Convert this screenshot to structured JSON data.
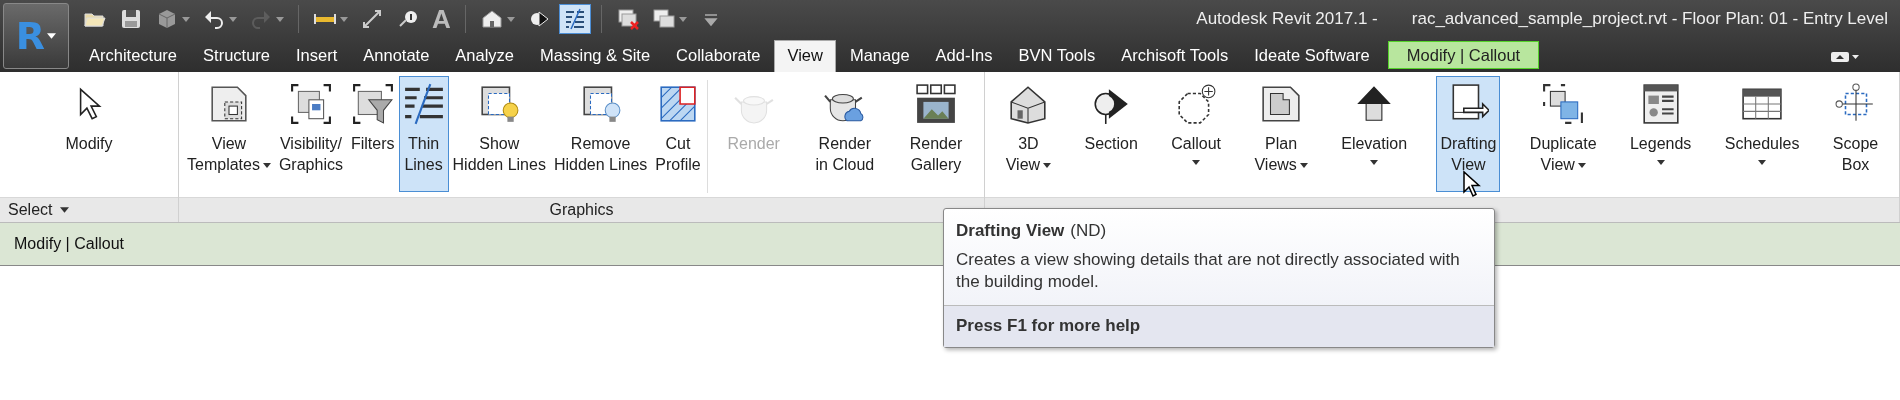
{
  "title_bar": {
    "app_button": {
      "label": "R"
    },
    "quick_access": [
      [
        {
          "kind": "open",
          "dropdown": false,
          "disabled": false,
          "active": false
        },
        {
          "kind": "save",
          "dropdown": false,
          "disabled": false,
          "active": false
        },
        {
          "kind": "sync",
          "dropdown": true,
          "disabled": false,
          "active": false
        },
        {
          "kind": "undo",
          "dropdown": true,
          "disabled": false,
          "active": false
        },
        {
          "kind": "redo",
          "dropdown": true,
          "disabled": true,
          "active": false
        }
      ],
      [
        {
          "kind": "measure",
          "dropdown": true,
          "disabled": false,
          "active": false
        },
        {
          "kind": "dimension",
          "dropdown": false,
          "disabled": false,
          "active": false
        },
        {
          "kind": "tag",
          "dropdown": false,
          "disabled": false,
          "active": false
        },
        {
          "kind": "text",
          "label": "A",
          "dropdown": false,
          "disabled": false,
          "active": false
        }
      ],
      [
        {
          "kind": "house",
          "dropdown": true,
          "disabled": false,
          "active": false
        },
        {
          "kind": "section",
          "dropdown": false,
          "disabled": false,
          "active": false
        },
        {
          "kind": "thin-lines",
          "dropdown": false,
          "disabled": false,
          "active": true
        }
      ],
      [
        {
          "kind": "close-windows",
          "dropdown": false,
          "disabled": false,
          "active": false
        },
        {
          "kind": "switch-windows",
          "dropdown": true,
          "disabled": false,
          "active": false
        },
        {
          "kind": "customize",
          "dropdown": false,
          "disabled": false,
          "active": false
        }
      ]
    ],
    "app_name": "Autodesk Revit 2017.1 -",
    "document": "rac_advanced_sample_project.rvt - Floor Plan: 01 - Entry Level"
  },
  "tabs": [
    {
      "label": "Architecture",
      "selected": false,
      "kind": "normal"
    },
    {
      "label": "Structure",
      "selected": false,
      "kind": "normal"
    },
    {
      "label": "Insert",
      "selected": false,
      "kind": "normal"
    },
    {
      "label": "Annotate",
      "selected": false,
      "kind": "normal"
    },
    {
      "label": "Analyze",
      "selected": false,
      "kind": "normal"
    },
    {
      "label": "Massing & Site",
      "selected": false,
      "kind": "normal"
    },
    {
      "label": "Collaborate",
      "selected": false,
      "kind": "normal"
    },
    {
      "label": "View",
      "selected": true,
      "kind": "normal"
    },
    {
      "label": "Manage",
      "selected": false,
      "kind": "normal"
    },
    {
      "label": "Add-Ins",
      "selected": false,
      "kind": "normal"
    },
    {
      "label": "BVN Tools",
      "selected": false,
      "kind": "normal"
    },
    {
      "label": "Archisoft Tools",
      "selected": false,
      "kind": "normal"
    },
    {
      "label": "Ideate Software",
      "selected": false,
      "kind": "normal"
    },
    {
      "label": "Modify | Callout",
      "selected": false,
      "kind": "contextual"
    }
  ],
  "ribbon": {
    "panels": [
      {
        "title": "Select",
        "title_dropdown": true,
        "groups": [
          [
            {
              "lines": [
                "Modify"
              ],
              "kind": "cursor",
              "dropdown": false,
              "selected": false,
              "disabled": false
            }
          ]
        ]
      },
      {
        "title": "Graphics",
        "title_dropdown": false,
        "groups": [
          [
            {
              "lines": [
                "View",
                "Templates"
              ],
              "kind": "view-templates",
              "dropdown": true,
              "selected": false,
              "disabled": false
            },
            {
              "lines": [
                "Visibility/",
                "Graphics"
              ],
              "kind": "visibility",
              "dropdown": false,
              "selected": false,
              "disabled": false
            },
            {
              "lines": [
                "Filters"
              ],
              "kind": "filters",
              "dropdown": false,
              "selected": false,
              "disabled": false
            },
            {
              "lines": [
                "Thin",
                "Lines"
              ],
              "kind": "thin-lines",
              "dropdown": false,
              "selected": true,
              "disabled": false
            },
            {
              "lines": [
                "Show",
                "Hidden Lines"
              ],
              "kind": "show-hidden",
              "dropdown": false,
              "selected": false,
              "disabled": false
            },
            {
              "lines": [
                "Remove",
                "Hidden Lines"
              ],
              "kind": "remove-hidden",
              "dropdown": false,
              "selected": false,
              "disabled": false
            },
            {
              "lines": [
                "Cut",
                "Profile"
              ],
              "kind": "cut-profile",
              "dropdown": false,
              "selected": false,
              "disabled": false
            }
          ],
          [
            {
              "lines": [
                "Render"
              ],
              "kind": "render",
              "dropdown": false,
              "selected": false,
              "disabled": true
            },
            {
              "lines": [
                "Render",
                "in Cloud"
              ],
              "kind": "render-cloud",
              "dropdown": false,
              "selected": false,
              "disabled": false
            },
            {
              "lines": [
                "Render",
                "Gallery"
              ],
              "kind": "render-gallery",
              "dropdown": false,
              "selected": false,
              "disabled": false
            }
          ]
        ]
      },
      {
        "title_dropdown": false,
        "groups": [
          [
            {
              "lines": [
                "3D",
                "View"
              ],
              "kind": "house3d",
              "dropdown": true,
              "selected": false,
              "disabled": false
            },
            {
              "lines": [
                "Section"
              ],
              "kind": "section",
              "dropdown": false,
              "selected": false,
              "disabled": false
            },
            {
              "lines": [
                "Callout"
              ],
              "kind": "callout",
              "dropdown": true,
              "selected": false,
              "disabled": false
            },
            {
              "lines": [
                "Plan",
                "Views"
              ],
              "kind": "plan-views",
              "dropdown": true,
              "selected": false,
              "disabled": false
            },
            {
              "lines": [
                "Elevation"
              ],
              "kind": "elevation",
              "dropdown": true,
              "selected": false,
              "disabled": false
            },
            {
              "lines": [
                "Drafting",
                "View"
              ],
              "kind": "drafting",
              "dropdown": false,
              "selected": true,
              "disabled": false
            },
            {
              "lines": [
                "Duplicate",
                "View"
              ],
              "kind": "duplicate",
              "dropdown": true,
              "selected": false,
              "disabled": false
            },
            {
              "lines": [
                "Legends"
              ],
              "kind": "legends",
              "dropdown": true,
              "selected": false,
              "disabled": false
            },
            {
              "lines": [
                "Schedules"
              ],
              "kind": "schedules",
              "dropdown": true,
              "selected": false,
              "disabled": false
            },
            {
              "lines": [
                "Scope",
                "Box"
              ],
              "kind": "scope-box",
              "dropdown": false,
              "selected": false,
              "disabled": false
            }
          ]
        ]
      }
    ]
  },
  "context_bar": {
    "label": "Modify | Callout"
  },
  "tooltip": {
    "title": "Drafting View",
    "shortcut": "(ND)",
    "description": "Creates a view showing details that are not directly associated with the building model.",
    "help": "Press F1 for more help"
  }
}
